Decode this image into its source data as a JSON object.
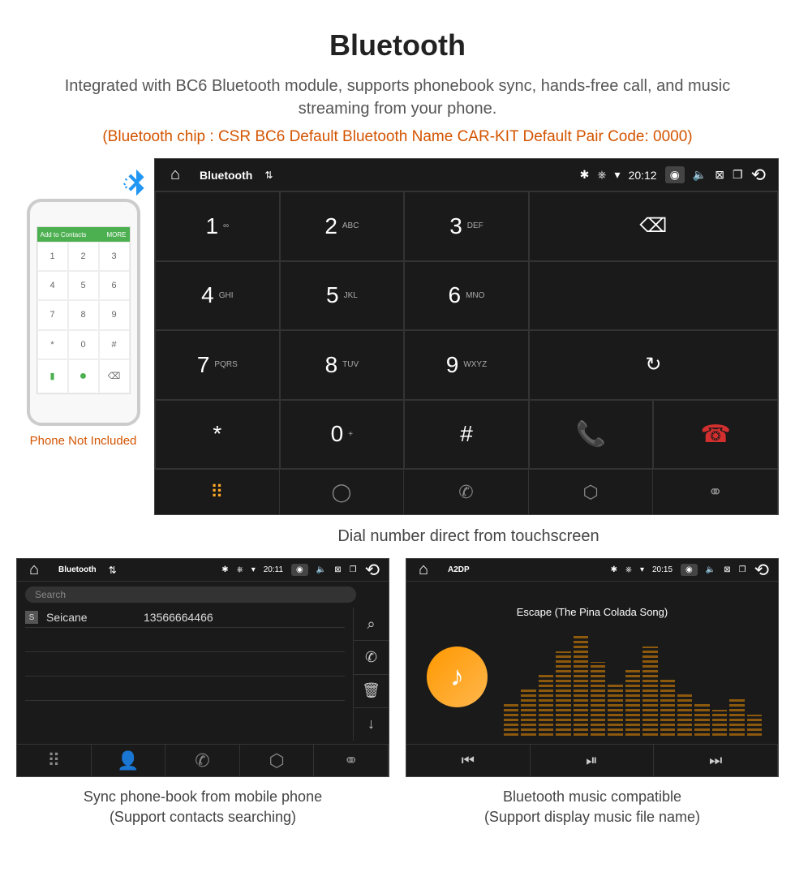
{
  "header": {
    "title": "Bluetooth",
    "description": "Integrated with BC6 Bluetooth module, supports phonebook sync, hands-free call, and music streaming from your phone.",
    "specs": "(Bluetooth chip : CSR BC6    Default Bluetooth Name CAR-KIT    Default Pair Code: 0000)"
  },
  "phone": {
    "top_left": "Add to Contacts",
    "top_right": "MORE",
    "keys": [
      "1",
      "2",
      "3",
      "4",
      "5",
      "6",
      "7",
      "8",
      "9",
      "*",
      "0",
      "#"
    ],
    "label": "Phone Not Included"
  },
  "main_device": {
    "status": {
      "title": "Bluetooth",
      "time": "20:12"
    },
    "keys": [
      {
        "main": "1",
        "sub": "∞"
      },
      {
        "main": "2",
        "sub": "ABC"
      },
      {
        "main": "3",
        "sub": "DEF"
      },
      {
        "main": "4",
        "sub": "GHI"
      },
      {
        "main": "5",
        "sub": "JKL"
      },
      {
        "main": "6",
        "sub": "MNO"
      },
      {
        "main": "7",
        "sub": "PQRS"
      },
      {
        "main": "8",
        "sub": "TUV"
      },
      {
        "main": "9",
        "sub": "WXYZ"
      },
      {
        "main": "*",
        "sub": ""
      },
      {
        "main": "0",
        "sub": "+"
      },
      {
        "main": "#",
        "sub": ""
      }
    ],
    "caption": "Dial number direct from touchscreen"
  },
  "contacts_device": {
    "status": {
      "title": "Bluetooth",
      "time": "20:11"
    },
    "search_placeholder": "Search",
    "contact": {
      "badge": "S",
      "name": "Seicane",
      "number": "13566664466"
    },
    "caption": "Sync phone-book from mobile phone",
    "caption2": "(Support contacts searching)"
  },
  "music_device": {
    "status": {
      "title": "A2DP",
      "time": "20:15"
    },
    "track": "Escape (The Pina Colada Song)",
    "caption": "Bluetooth music compatible",
    "caption2": "(Support display music file name)"
  }
}
